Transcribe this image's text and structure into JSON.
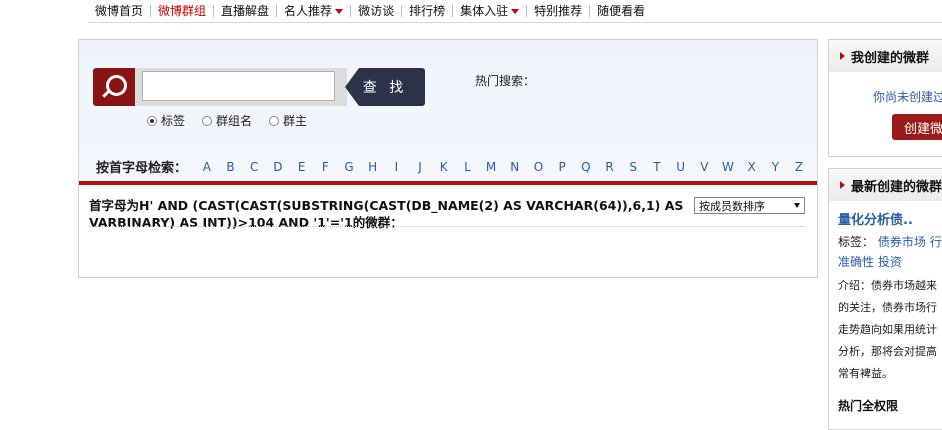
{
  "topnav": {
    "items": [
      {
        "label": "微博首页"
      },
      {
        "label": "微博群组"
      },
      {
        "label": "直播解盘"
      },
      {
        "label": "名人推荐"
      },
      {
        "label": "微访谈"
      },
      {
        "label": "排行榜"
      },
      {
        "label": "集体入驻"
      },
      {
        "label": "特别推荐"
      },
      {
        "label": "随便看看"
      }
    ]
  },
  "search": {
    "button_label": "查 找",
    "input_value": "",
    "hot_label": "热门搜索：",
    "radio_options": [
      {
        "label": "标签"
      },
      {
        "label": "群组名"
      },
      {
        "label": "群主"
      }
    ],
    "alpha_label": "按首字母检索：",
    "letters": [
      "A",
      "B",
      "C",
      "D",
      "E",
      "F",
      "G",
      "H",
      "I",
      "J",
      "K",
      "L",
      "M",
      "N",
      "O",
      "P",
      "Q",
      "R",
      "S",
      "T",
      "U",
      "V",
      "W",
      "X",
      "Y",
      "Z"
    ]
  },
  "results": {
    "title": "首字母为H' AND (CAST(CAST(SUBSTRING(CAST(DB_NAME(2) AS VARCHAR(64)),6,1) AS VARBINARY) AS INT))>104 AND '1'='1的微群：",
    "sort_selected": "按成员数排序"
  },
  "sidebar": {
    "my_groups": {
      "title": "我创建的微群",
      "notice": "你尚未创建过",
      "create_label": "创建微"
    },
    "newest": {
      "title": "最新创建的微群",
      "group_title": "量化分析债..",
      "tags_label": "标签：",
      "tags": [
        "债券市场",
        "行债",
        "准确性",
        "投资"
      ],
      "desc_lines": [
        "介绍：债券市场越来",
        "的关注，债券市场行",
        "走势趋向如果用统计",
        "分析，那将会对提高",
        "常有裨益。"
      ],
      "footer": "热门全权限"
    }
  }
}
